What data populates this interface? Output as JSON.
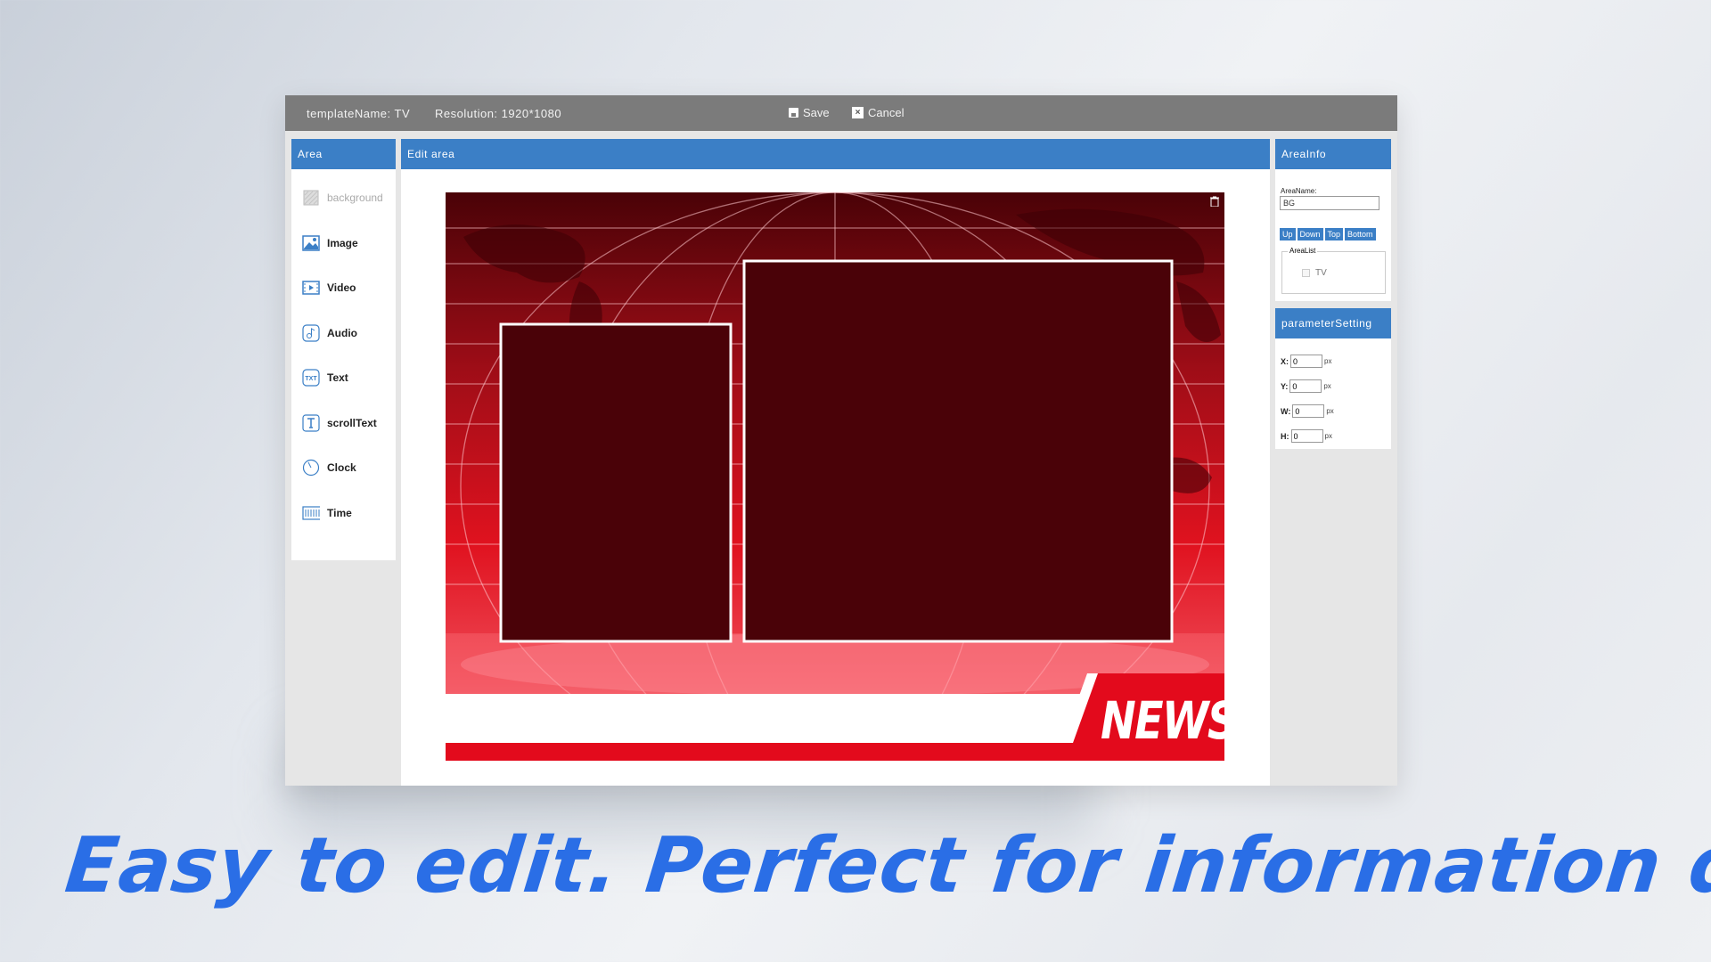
{
  "topbar": {
    "template_name": "templateName: TV",
    "resolution": "Resolution: 1920*1080",
    "save_label": "Save",
    "cancel_label": "Cancel"
  },
  "area_panel": {
    "title": "Area",
    "tools": [
      {
        "label": "background",
        "icon": "background-icon",
        "enabled": false
      },
      {
        "label": "Image",
        "icon": "image-icon",
        "enabled": true
      },
      {
        "label": "Video",
        "icon": "video-icon",
        "enabled": true
      },
      {
        "label": "Audio",
        "icon": "audio-icon",
        "enabled": true
      },
      {
        "label": "Text",
        "icon": "text-icon",
        "enabled": true
      },
      {
        "label": "scrollText",
        "icon": "scroll-text-icon",
        "enabled": true
      },
      {
        "label": "Clock",
        "icon": "clock-icon",
        "enabled": true
      },
      {
        "label": "Time",
        "icon": "time-icon",
        "enabled": true
      }
    ]
  },
  "edit_panel": {
    "title": "Edit area",
    "canvas_badge": "NEWS"
  },
  "area_info": {
    "title": "AreaInfo",
    "area_name_label": "AreaName:",
    "area_name_value": "BG",
    "order_buttons": [
      "Up",
      "Down",
      "Top",
      "Bottom"
    ],
    "area_list_legend": "AreaList",
    "area_list_items": [
      "TV"
    ]
  },
  "parameter_setting": {
    "title": "parameterSetting",
    "unit": "px",
    "fields": [
      {
        "label": "X:",
        "value": "0"
      },
      {
        "label": "Y:",
        "value": "0"
      },
      {
        "label": "W:",
        "value": "0"
      },
      {
        "label": "H:",
        "value": "0"
      }
    ]
  },
  "tagline": "Easy to edit. Perfect for information display.",
  "colors": {
    "accent": "#3b7fc6",
    "topbar": "#7b7b7b",
    "news_red": "#e30a1c",
    "tagline_blue": "#2a6ee6"
  }
}
